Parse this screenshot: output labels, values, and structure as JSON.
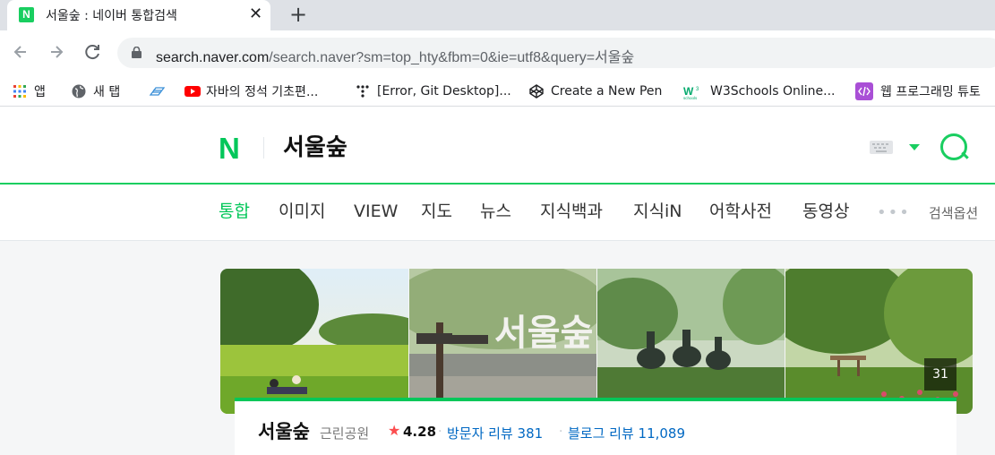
{
  "browser": {
    "tab_title": "서울숲 : 네이버 통합검색",
    "tab_favicon_letter": "N",
    "close_glyph": "✕",
    "new_tab_glyph": "+",
    "url_host": "search.naver.com",
    "url_path": "/search.naver?sm=top_hty&fbm=0&ie=utf8&query=서울숲",
    "bookmarks": [
      {
        "label": "앱",
        "icon": "apps-grid-icon"
      },
      {
        "label": "새 탭",
        "icon": "globe-icon"
      },
      {
        "label": "",
        "icon": "layers-icon"
      },
      {
        "label": "자바의 정석 기초편...",
        "icon": "youtube-icon"
      },
      {
        "label": "[Error, Git Desktop]...",
        "icon": "dots-icon"
      },
      {
        "label": "Create a New Pen",
        "icon": "codepen-icon"
      },
      {
        "label": "W3Schools Online...",
        "icon": "w3schools-icon"
      },
      {
        "label": "웹 프로그래밍 튜토",
        "icon": "code-icon"
      }
    ]
  },
  "header": {
    "logo": "N",
    "query": "서울숲"
  },
  "nav": {
    "tabs": [
      "통합",
      "이미지",
      "VIEW",
      "지도",
      "뉴스",
      "지식백과",
      "지식iN",
      "어학사전",
      "동영상"
    ],
    "active_index": 0,
    "more": "•••",
    "options": "검색옵션"
  },
  "place": {
    "photo_count": "31",
    "name": "서울숲",
    "category": "근린공원",
    "star": "★",
    "rating": "4.28",
    "dot": "·",
    "visitor_review": "방문자 리뷰 381",
    "blog_review": "블로그 리뷰 11,089"
  },
  "colors": {
    "naver_green": "#03c75a",
    "link_blue": "#0068c3",
    "star_red": "#fc4c4e"
  }
}
